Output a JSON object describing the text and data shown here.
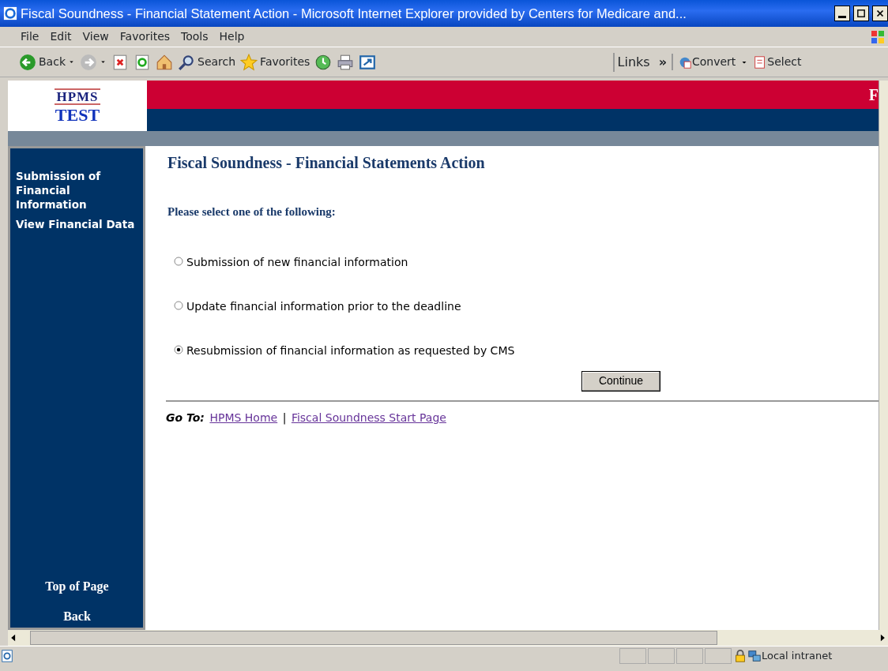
{
  "window": {
    "title": "Fiscal Soundness - Financial Statement Action - Microsoft Internet Explorer provided by Centers for Medicare and..."
  },
  "menu": [
    "File",
    "Edit",
    "View",
    "Favorites",
    "Tools",
    "Help"
  ],
  "toolbar": [
    {
      "kind": "back",
      "label": "Back"
    },
    {
      "kind": "forward"
    },
    {
      "kind": "stop"
    },
    {
      "kind": "refresh"
    },
    {
      "kind": "home"
    },
    {
      "kind": "search",
      "label": "Search"
    },
    {
      "kind": "favorites",
      "label": "Favorites"
    },
    {
      "kind": "history"
    },
    {
      "kind": "print"
    },
    {
      "kind": "window"
    }
  ],
  "links_bar": {
    "label": "Links",
    "chevron": "»"
  },
  "pdf_bar": [
    {
      "kind": "convert",
      "label": "Convert"
    },
    {
      "kind": "select",
      "label": "Select"
    }
  ],
  "header": {
    "logo_top": "HPMS",
    "logo_bottom": "TEST",
    "banner_text": "F"
  },
  "sidebar": {
    "items": [
      "Submission of Financial Information",
      "View Financial Data"
    ],
    "bottom_links": [
      "Top of Page",
      "Back"
    ]
  },
  "page": {
    "heading": "Fiscal Soundness - Financial Statements Action",
    "prompt": "Please select one of the following:",
    "options": [
      {
        "label": "Submission of new financial information",
        "selected": false
      },
      {
        "label": "Update financial information prior to the deadline",
        "selected": false
      },
      {
        "label": "Resubmission of financial information as requested by CMS",
        "selected": true
      }
    ],
    "button": "Continue",
    "goto_label": "Go To:",
    "links": [
      "HPMS Home",
      "Fiscal Soundness Start Page"
    ],
    "link_separator": "|"
  },
  "status_bar": {
    "zone": "Local intranet"
  }
}
